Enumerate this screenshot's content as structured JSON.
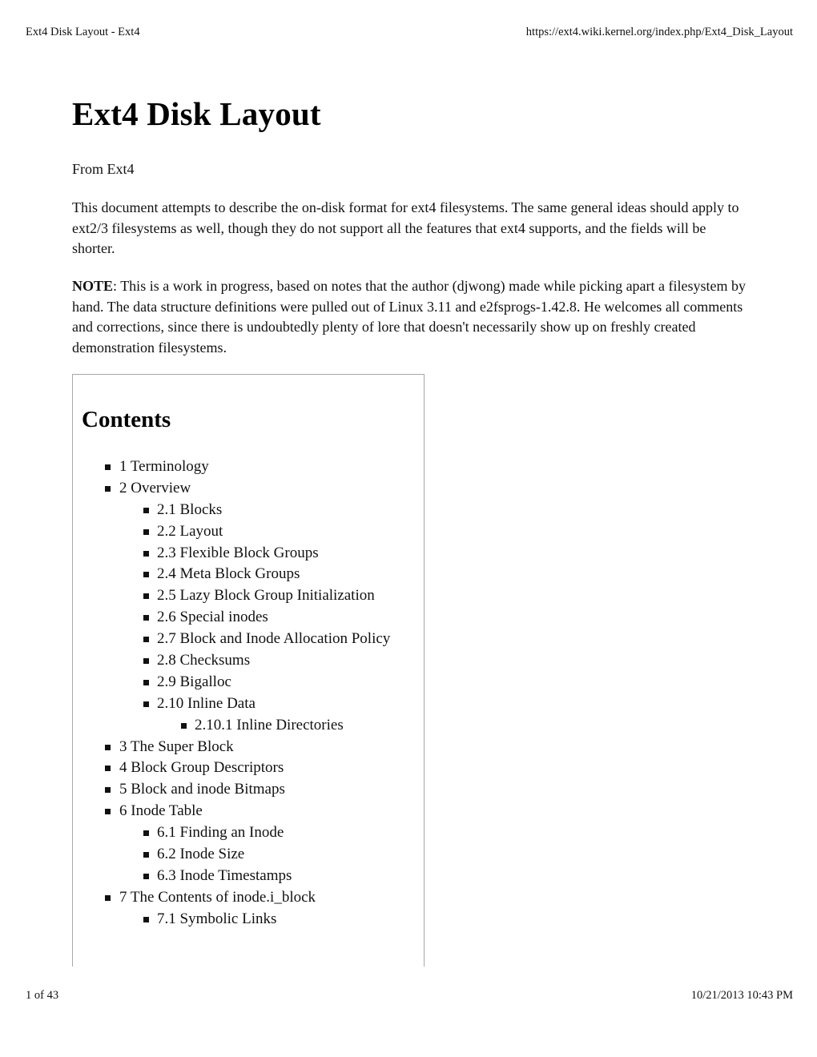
{
  "print_header": {
    "page_title": "Ext4 Disk Layout - Ext4",
    "url": "https://ext4.wiki.kernel.org/index.php/Ext4_Disk_Layout"
  },
  "article": {
    "title": "Ext4 Disk Layout",
    "from_line": "From Ext4",
    "intro": "This document attempts to describe the on-disk format for ext4 filesystems. The same general ideas should apply to ext2/3 filesystems as well, though they do not support all the features that ext4 supports, and the fields will be shorter.",
    "note_label": "NOTE",
    "note_text": ": This is a work in progress, based on notes that the author (djwong) made while picking apart a filesystem by hand. The data structure definitions were pulled out of Linux 3.11 and e2fsprogs-1.42.8. He welcomes all comments and corrections, since there is undoubtedly plenty of lore that doesn't necessarily show up on freshly created demonstration filesystems."
  },
  "toc": {
    "title": "Contents",
    "items": [
      {
        "label": "1 Terminology",
        "level": 1
      },
      {
        "label": "2 Overview",
        "level": 1
      },
      {
        "label": "2.1 Blocks",
        "level": 2
      },
      {
        "label": "2.2 Layout",
        "level": 2
      },
      {
        "label": "2.3 Flexible Block Groups",
        "level": 2
      },
      {
        "label": "2.4 Meta Block Groups",
        "level": 2
      },
      {
        "label": "2.5 Lazy Block Group Initialization",
        "level": 2
      },
      {
        "label": "2.6 Special inodes",
        "level": 2
      },
      {
        "label": "2.7 Block and Inode Allocation Policy",
        "level": 2
      },
      {
        "label": "2.8 Checksums",
        "level": 2
      },
      {
        "label": "2.9 Bigalloc",
        "level": 2
      },
      {
        "label": "2.10 Inline Data",
        "level": 2
      },
      {
        "label": "2.10.1 Inline Directories",
        "level": 3
      },
      {
        "label": "3 The Super Block",
        "level": 1
      },
      {
        "label": "4 Block Group Descriptors",
        "level": 1
      },
      {
        "label": "5 Block and inode Bitmaps",
        "level": 1
      },
      {
        "label": "6 Inode Table",
        "level": 1
      },
      {
        "label": "6.1 Finding an Inode",
        "level": 2
      },
      {
        "label": "6.2 Inode Size",
        "level": 2
      },
      {
        "label": "6.3 Inode Timestamps",
        "level": 2
      },
      {
        "label": "7 The Contents of inode.i_block",
        "level": 1
      },
      {
        "label": "7.1 Symbolic Links",
        "level": 2
      }
    ]
  },
  "print_footer": {
    "page_number": "1 of 43",
    "datetime": "10/21/2013 10:43 PM"
  }
}
